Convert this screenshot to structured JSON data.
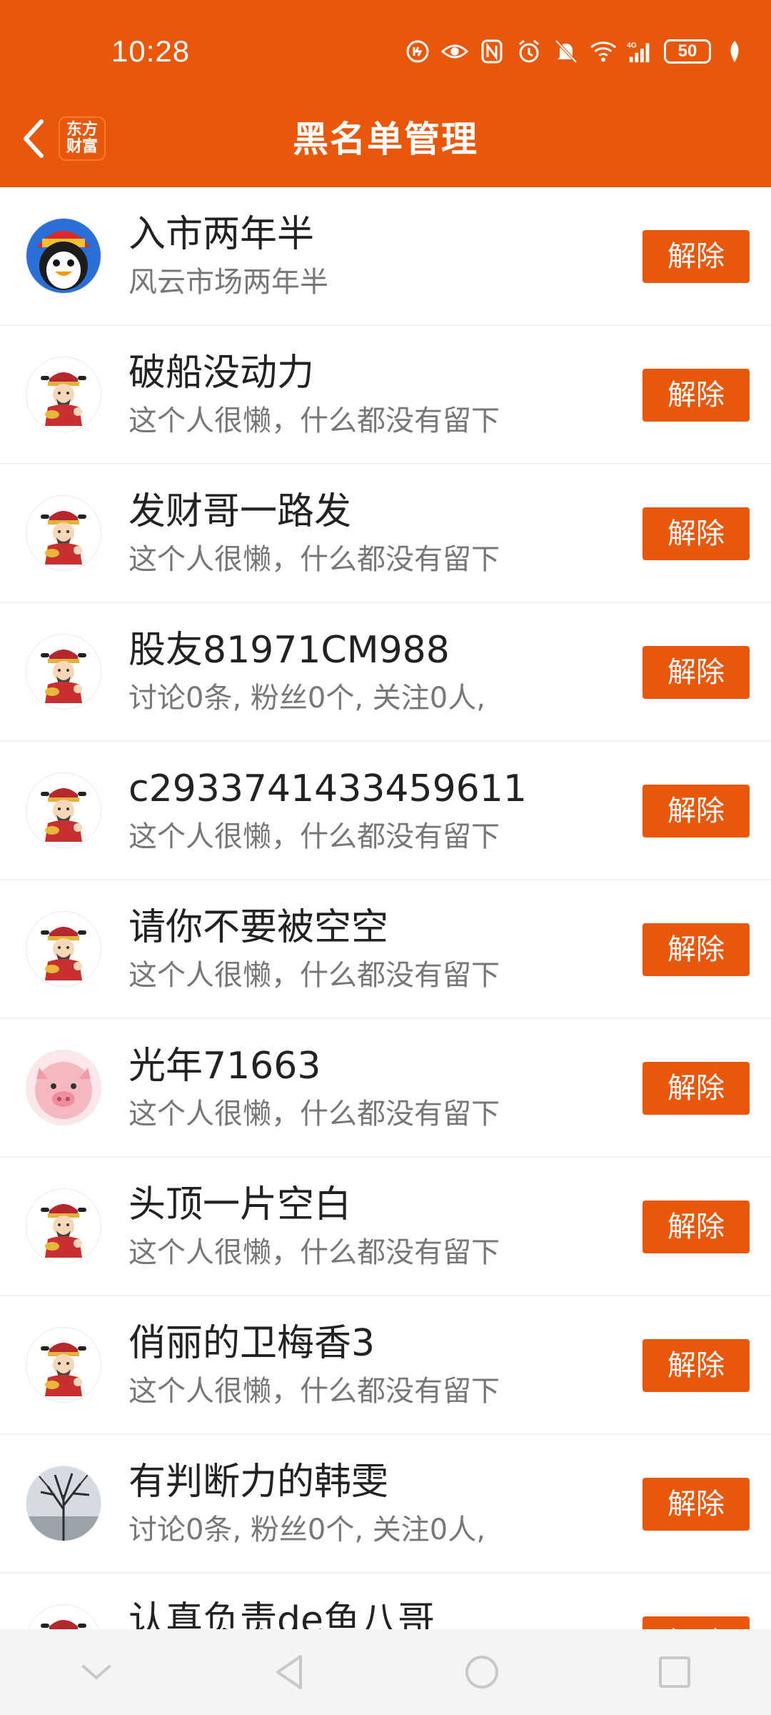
{
  "status": {
    "time": "10:28",
    "battery": "50"
  },
  "header": {
    "title": "黑名单管理",
    "logo_line1": "东方",
    "logo_line2": "财富"
  },
  "colors": {
    "accent": "#e8580c"
  },
  "list": {
    "items": [
      {
        "name": "入市两年半",
        "desc": "风云市场两年半",
        "avatar": "caishen-penguin",
        "action": "解除"
      },
      {
        "name": "破船没动力",
        "desc": "这个人很懒，什么都没有留下",
        "avatar": "caishen",
        "action": "解除"
      },
      {
        "name": "发财哥一路发",
        "desc": "这个人很懒，什么都没有留下",
        "avatar": "caishen",
        "action": "解除"
      },
      {
        "name": "股友81971CM988",
        "desc": "讨论0条, 粉丝0个, 关注0人,",
        "avatar": "caishen",
        "action": "解除"
      },
      {
        "name": "c2933741433459611",
        "desc": "这个人很懒，什么都没有留下",
        "avatar": "caishen",
        "action": "解除"
      },
      {
        "name": "请你不要被空空",
        "desc": "这个人很懒，什么都没有留下",
        "avatar": "caishen",
        "action": "解除"
      },
      {
        "name": "光年71663",
        "desc": "这个人很懒，什么都没有留下",
        "avatar": "pig",
        "action": "解除"
      },
      {
        "name": "头顶一片空白",
        "desc": "这个人很懒，什么都没有留下",
        "avatar": "caishen",
        "action": "解除"
      },
      {
        "name": "俏丽的卫梅香3",
        "desc": "这个人很懒，什么都没有留下",
        "avatar": "caishen",
        "action": "解除"
      },
      {
        "name": "有判断力的韩雯",
        "desc": "讨论0条, 粉丝0个, 关注0人,",
        "avatar": "tree-photo",
        "action": "解除"
      },
      {
        "name": "认真负责de鱼八哥",
        "desc": "",
        "avatar": "caishen",
        "action": "解除"
      }
    ]
  }
}
